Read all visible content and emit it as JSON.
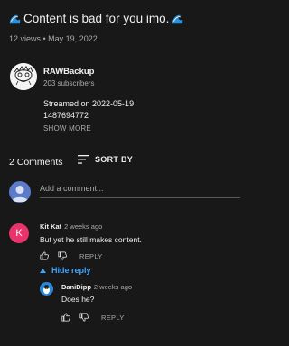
{
  "video": {
    "title": "Content is bad for you imo.",
    "meta": "12 views • May 19, 2022"
  },
  "channel": {
    "name": "RAWBackup",
    "subscribers": "203 subscribers",
    "description_line1": "Streamed on 2022-05-19",
    "description_line2": "1487694772",
    "show_more": "SHOW MORE"
  },
  "comments_header": {
    "count": "2 Comments",
    "sort_label": "SORT BY"
  },
  "add_comment": {
    "placeholder": "Add a comment..."
  },
  "comments": [
    {
      "avatar_letter": "K",
      "author": "Kit Kat",
      "time": "2 weeks ago",
      "text": "But yet he still makes content.",
      "reply_label": "REPLY",
      "avatar_color": "#e8346a"
    }
  ],
  "hide_reply_label": "Hide reply",
  "replies": [
    {
      "author": "DaniDipp",
      "time": "2 weeks ago",
      "text": "Does he?",
      "reply_label": "REPLY"
    }
  ],
  "colors": {
    "background": "#181818",
    "accent_link": "#3ea6ff",
    "muted_text": "#aaaaaa"
  }
}
